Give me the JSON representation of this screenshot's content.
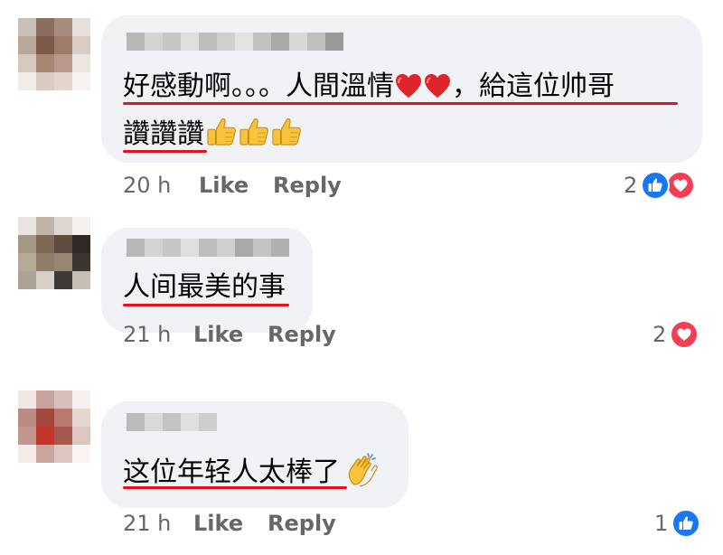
{
  "comments": [
    {
      "text_line1": "好感動啊。。。人間溫情",
      "text_line1_tail": "，給這位帅哥",
      "text_line2": "讚讚讚",
      "time": "20 h",
      "like_label": "Like",
      "reply_label": "Reply",
      "reaction_count": "2",
      "reactions": [
        "like-icon",
        "love-icon"
      ]
    },
    {
      "text_line1": "人间最美的事",
      "time": "21 h",
      "like_label": "Like",
      "reply_label": "Reply",
      "reaction_count": "2",
      "reactions": [
        "love-icon"
      ]
    },
    {
      "text_line1": "这位年轻人太棒了",
      "time": "21 h",
      "like_label": "Like",
      "reply_label": "Reply",
      "reaction_count": "1",
      "reactions": [
        "like-icon"
      ]
    }
  ],
  "colors": {
    "bubble": "#f0f2f5",
    "underline": "#e5141c",
    "meta_text": "#65676b",
    "like_blue": "#1877f2",
    "love_red": "#f33e58"
  }
}
